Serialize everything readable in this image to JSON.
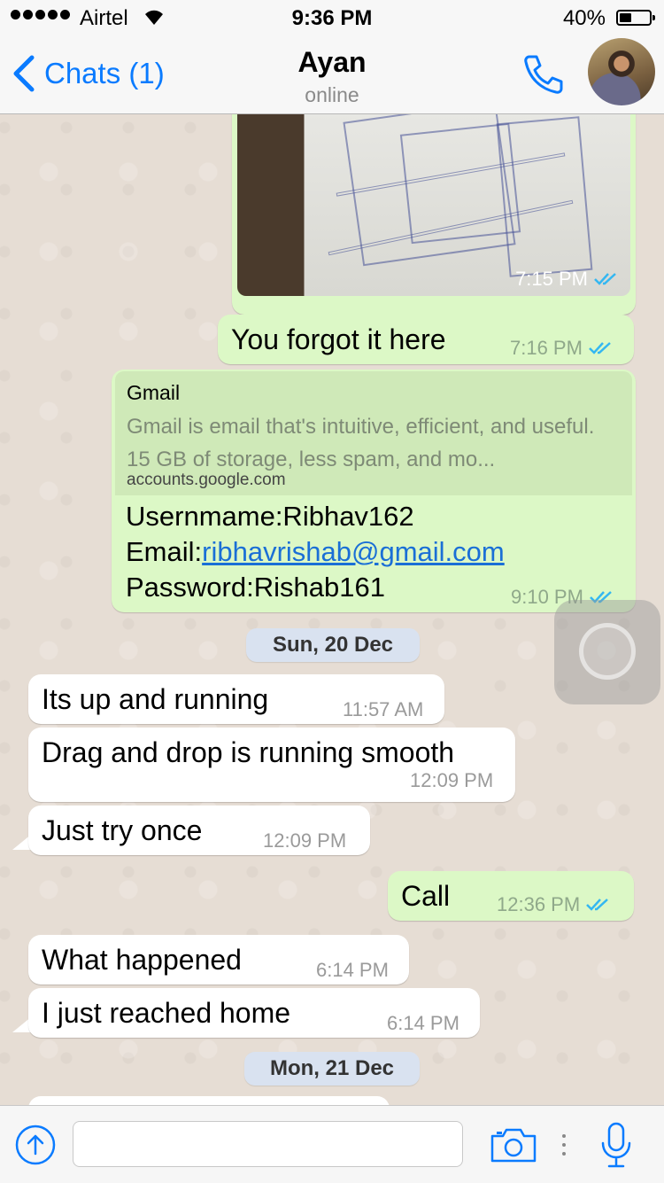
{
  "status_bar": {
    "carrier": "Airtel",
    "time": "9:36 PM",
    "battery_percent": "40%",
    "battery_level": 0.4
  },
  "nav": {
    "back_label": "Chats (1)",
    "contact_name": "Ayan",
    "contact_status": "online"
  },
  "messages": {
    "photo": {
      "time": "7:15 PM"
    },
    "forgot": {
      "text": "You forgot it here",
      "time": "7:16 PM"
    },
    "link": {
      "title": "Gmail",
      "description": "Gmail is email that's intuitive, efficient, and useful. 15 GB of storage, less spam, and mo...",
      "url": "accounts.google.com",
      "line1": "Usernmame:Ribhav162",
      "line2_label": "Email:",
      "line2_link": "ribhavrishab@gmail.com",
      "line3": "Password:Rishab161",
      "time": "9:10 PM"
    },
    "date1": "Sun, 20 Dec",
    "m1": {
      "text": "Its up and running",
      "time": "11:57 AM"
    },
    "m2": {
      "text": "Drag and drop is running smooth",
      "time": "12:09 PM"
    },
    "m3": {
      "text": "Just try once",
      "time": "12:09 PM"
    },
    "m4": {
      "text": "Call",
      "time": "12:36 PM"
    },
    "m5": {
      "text": "What happened",
      "time": "6:14 PM"
    },
    "m6": {
      "text": "I just reached home",
      "time": "6:14 PM"
    },
    "date2": "Mon, 21 Dec"
  },
  "input": {
    "value": "",
    "placeholder": ""
  },
  "colors": {
    "accent": "#0a7bff",
    "outgoing_bubble": "#dcf8c6",
    "incoming_bubble": "#ffffff",
    "read_ticks": "#34b7f1",
    "date_pill": "#d9e2f0"
  },
  "icons": [
    "signal-icon",
    "wifi-icon",
    "battery-icon",
    "back-chevron-icon",
    "phone-icon",
    "read-ticks-icon",
    "attach-upload-icon",
    "camera-icon",
    "microphone-icon"
  ]
}
